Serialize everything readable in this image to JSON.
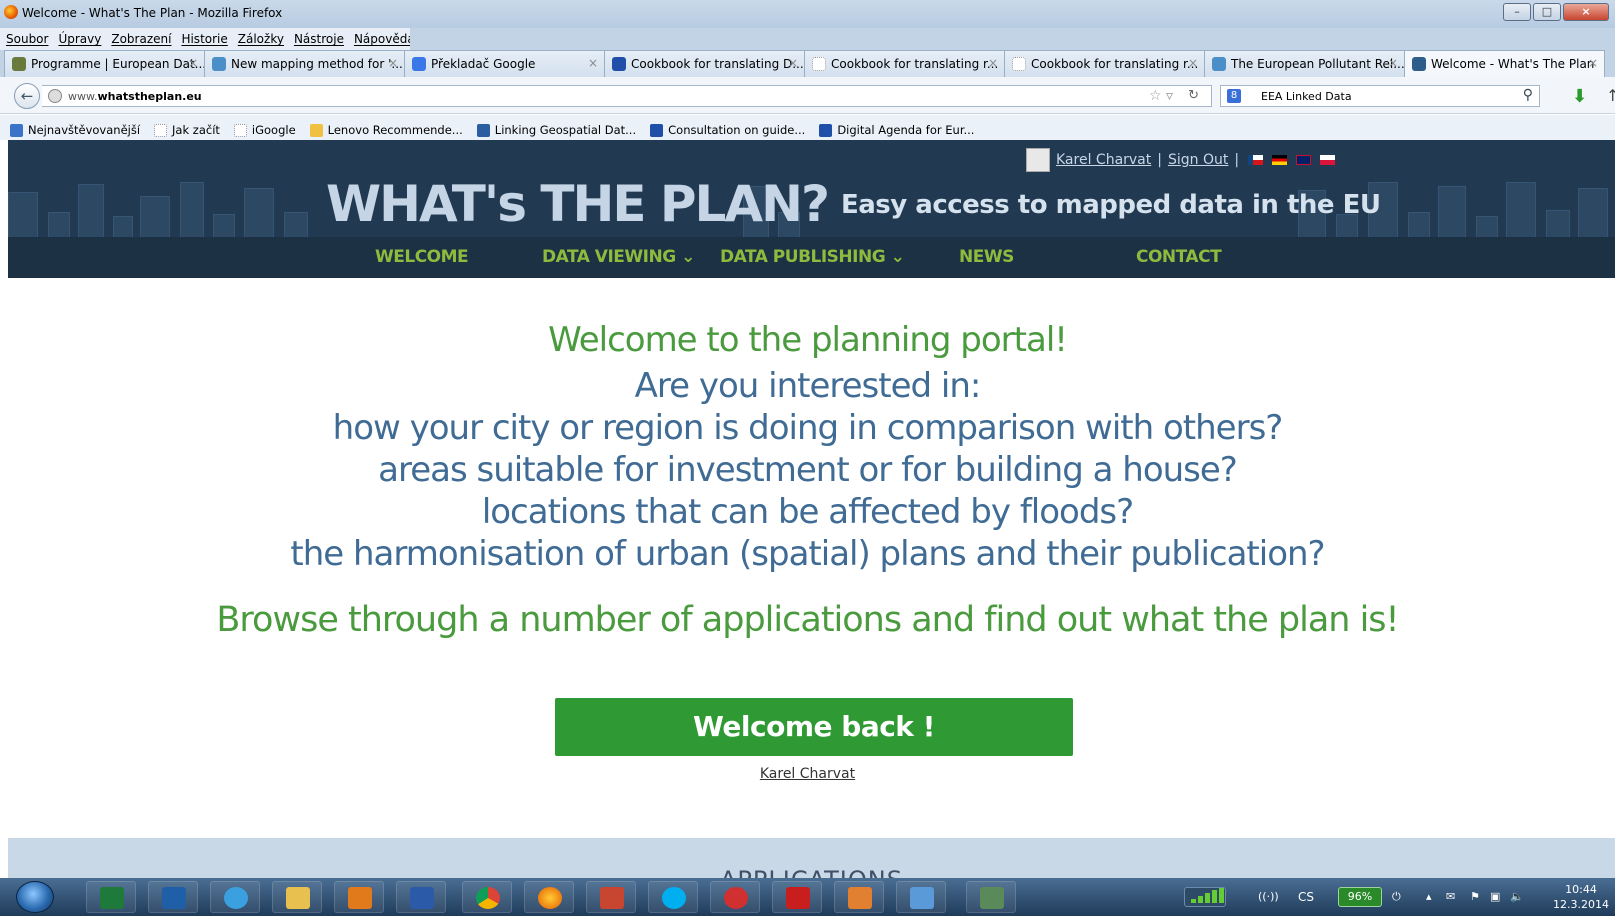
{
  "window": {
    "title": "Welcome - What's The Plan - Mozilla Firefox"
  },
  "menubar": {
    "items": [
      "Soubor",
      "Úpravy",
      "Zobrazení",
      "Historie",
      "Záložky",
      "Nástroje",
      "Nápověda"
    ]
  },
  "tabs": [
    {
      "label": "Programme | European Dat...",
      "icon_color": "#6a7a3a"
    },
    {
      "label": "New mapping method for '...",
      "icon_color": "#4a8fc8"
    },
    {
      "label": "Překladač Google",
      "icon_color": "#3b78e7"
    },
    {
      "label": "Cookbook for translating D...",
      "icon_color": "#1f4fa8"
    },
    {
      "label": "Cookbook for translating r...",
      "icon_color": "#cccccc"
    },
    {
      "label": "Cookbook for translating r...",
      "icon_color": "#cccccc"
    },
    {
      "label": "The European Pollutant Rel...",
      "icon_color": "#4a8fc8"
    },
    {
      "label": "Welcome - What's The Plan",
      "icon_color": "#2d5d8a"
    }
  ],
  "navbar": {
    "url_prefix": "www.",
    "url_domain": "whatstheplan.eu",
    "search_engine_label": "EEA Linked Data"
  },
  "bookmarks": [
    {
      "label": "Nejnavštěvovanější",
      "icon_color": "#3a74c8"
    },
    {
      "label": "Jak začít",
      "icon_color": "#dddddd"
    },
    {
      "label": "iGoogle",
      "icon_color": "#dddddd"
    },
    {
      "label": "Lenovo Recommende...",
      "icon_color": "#f0c040"
    },
    {
      "label": "Linking Geospatial Dat...",
      "icon_color": "#2a5ea0"
    },
    {
      "label": "Consultation on guide...",
      "icon_color": "#1f4fa8"
    },
    {
      "label": "Digital Agenda for Eur...",
      "icon_color": "#1f4fa8"
    }
  ],
  "site": {
    "logo": "WHAT's THE PLAN?",
    "tagline": "Easy access to mapped data in the EU",
    "user_name": "Karel Charvat",
    "separator": "|",
    "sign_out": "Sign Out",
    "nav": [
      "WELCOME",
      "DATA VIEWING",
      "DATA PUBLISHING",
      "NEWS",
      "CONTACT"
    ],
    "dropdown_marker": "⌄"
  },
  "content": {
    "welcome_heading": "Welcome to the planning portal!",
    "questions": [
      "Are you interested in:",
      "how your city or region is doing in comparison with others?",
      "areas suitable for investment or for building a house?",
      "locations that can be affected by floods?",
      "the harmonisation of urban (spatial) plans and their publication?"
    ],
    "browse_line": "Browse through a number of applications and find out what the plan is!",
    "welcome_back_button": "Welcome back !",
    "user_link": "Karel Charvat",
    "applications_heading": "APPLICATIONS"
  },
  "taskbar": {
    "language": "CS",
    "battery": "96%",
    "time": "10:44",
    "date": "12.3.2014"
  },
  "colors": {
    "header_bg": "#213a52",
    "nav_green": "#8dbb3d",
    "heading_green": "#4a9a3e",
    "question_blue": "#3f6b94",
    "button_green": "#2f9a33"
  }
}
